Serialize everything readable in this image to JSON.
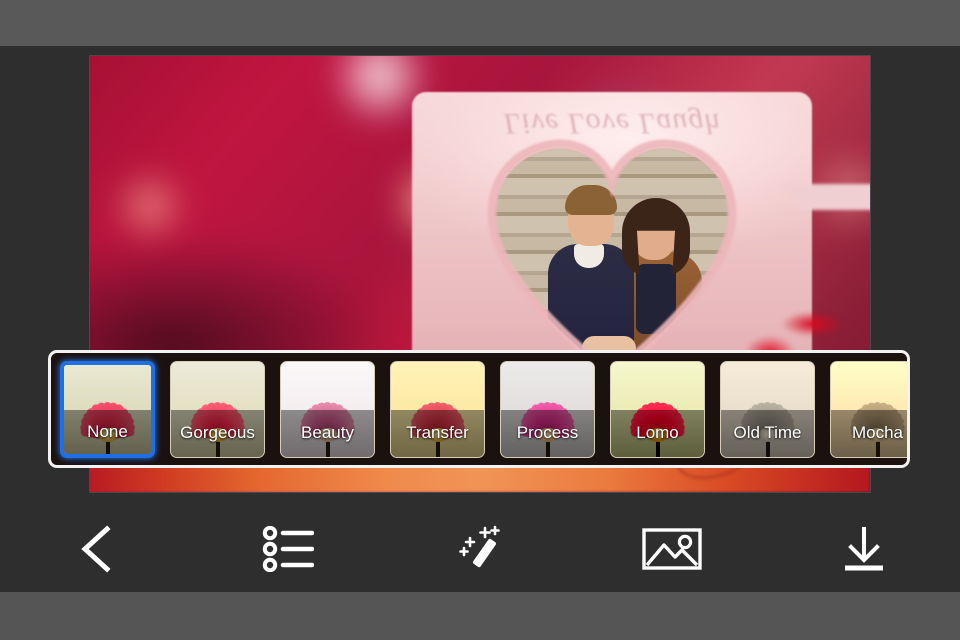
{
  "app": {
    "screen_name": "Photo Filter Editor",
    "background_color": "#2c2c2c",
    "top_band_color": "#595959",
    "bottom_band_color": "#555555",
    "toolbar_color": "#2e2e2e",
    "selection_color": "#1f6fe5",
    "strip_border_color": "#f2f2f2",
    "strip_background_color": "#1b1210"
  },
  "photo": {
    "alt": "Couple photo inside a heart-shaped window on a pink love mug with blurred red bokeh background",
    "mug_text": "Live Love Laugh"
  },
  "filters": {
    "selected_index": 0,
    "items": [
      {
        "label": "None",
        "tint": "none",
        "selected": true
      },
      {
        "label": "Gorgeous",
        "tint": "gorgeous",
        "selected": false
      },
      {
        "label": "Beauty",
        "tint": "beauty",
        "selected": false
      },
      {
        "label": "Transfer",
        "tint": "transfer",
        "selected": false
      },
      {
        "label": "Process",
        "tint": "process",
        "selected": false
      },
      {
        "label": "Lomo",
        "tint": "lomo",
        "selected": false
      },
      {
        "label": "Old Time",
        "tint": "oldtime",
        "selected": false
      },
      {
        "label": "Mocha",
        "tint": "mocha",
        "selected": false
      }
    ]
  },
  "toolbar": {
    "items": [
      {
        "name": "back-button",
        "icon": "chevron-left-icon"
      },
      {
        "name": "list-button",
        "icon": "list-icon"
      },
      {
        "name": "effects-button",
        "icon": "magic-wand-icon"
      },
      {
        "name": "gallery-button",
        "icon": "image-icon"
      },
      {
        "name": "save-button",
        "icon": "download-icon"
      }
    ]
  }
}
